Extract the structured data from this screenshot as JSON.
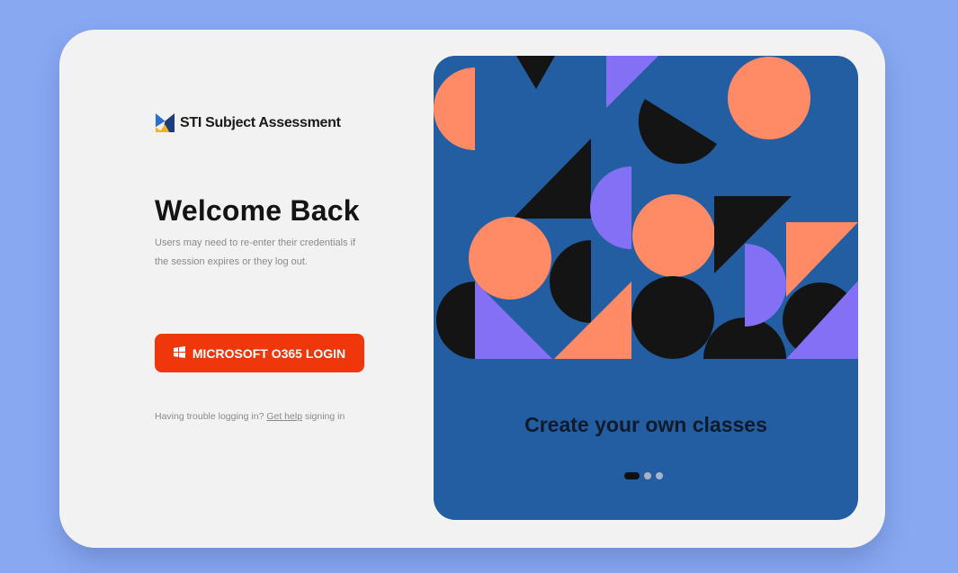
{
  "brand": {
    "name": "STI Subject Assessment",
    "logo_icon": "sti-logo-icon"
  },
  "welcome": {
    "title": "Welcome Back",
    "subtitle": "Users may need to re-enter their credentials if the session expires or they log out."
  },
  "login": {
    "label": "MICROSOFT O365 LOGIN",
    "icon": "windows-icon"
  },
  "help": {
    "prefix": "Having trouble logging in? ",
    "link": "Get help",
    "suffix": " signing in"
  },
  "carousel": {
    "caption": "Create your own classes",
    "slide_count": 3,
    "active_slide": 1
  },
  "colors": {
    "background": "#88a9f2",
    "card": "#f2f2f2",
    "accent": "#f0360b",
    "panel": "#235ea3",
    "orange": "#ff8a66",
    "purple": "#8370f5",
    "black": "#141414"
  }
}
